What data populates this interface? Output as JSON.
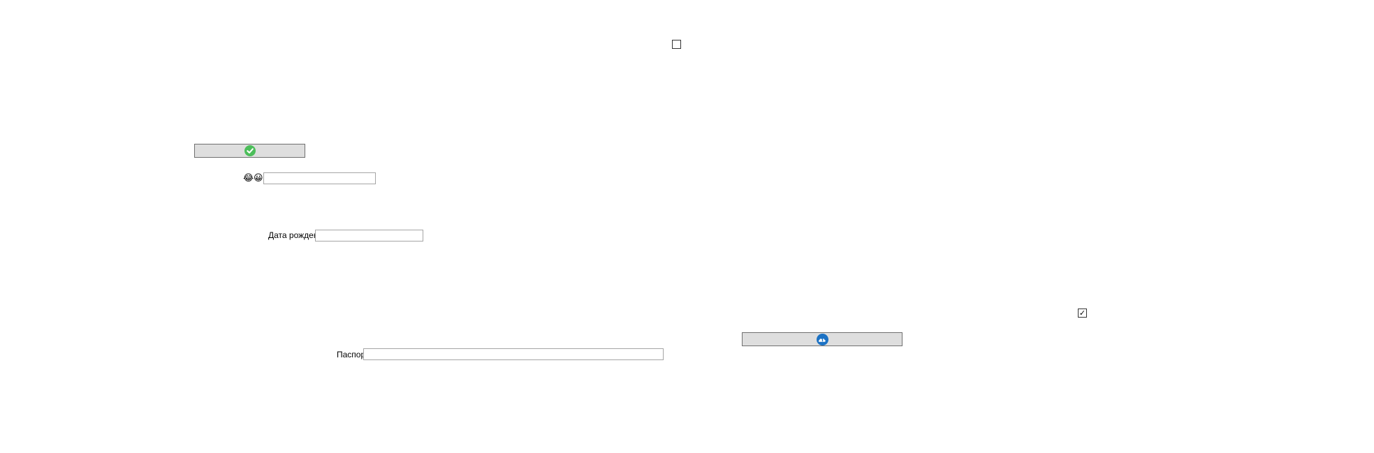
{
  "confirm_button": {
    "icon": "check-circle-icon",
    "icon_color": "#4cbe5a"
  },
  "cloud_button": {
    "icon": "cloud-upload-icon",
    "icon_color": "#1c72c4"
  },
  "top_checkbox": {
    "checked": false
  },
  "bottom_checkbox": {
    "checked": true,
    "mark": "✓"
  },
  "emoji_field": {
    "icons": [
      "😂",
      "😀"
    ],
    "value": ""
  },
  "birthdate_field": {
    "label": "Дата рождения",
    "value": ""
  },
  "passport_field": {
    "label": "Паспорт",
    "value": ""
  }
}
